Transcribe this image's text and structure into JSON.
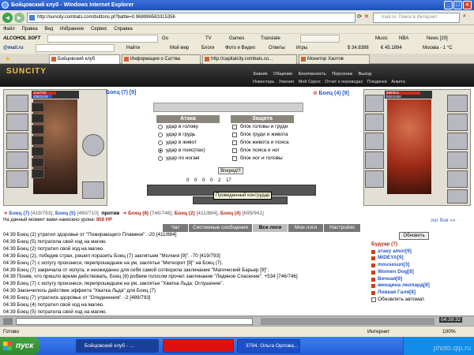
{
  "window": {
    "title": "Бойцовский клуб - Windows Internet Explorer"
  },
  "address": {
    "url": "http://suncity.combats.com/buttons.pl?battle=0.968996583315356",
    "search_placeholder": "mail.ru: Поиск в Интернет"
  },
  "menu": [
    "Файл",
    "Правка",
    "Вид",
    "Избранное",
    "Сервис",
    "Справка"
  ],
  "toolbar1": {
    "alcohol": "ALCOHOL SOFT",
    "go": "Go",
    "tv": "TV",
    "games": "Games",
    "translate": "Translate",
    "music": "Music",
    "nba": "NBA",
    "news": "News [20]"
  },
  "toolbar2": {
    "mailru": "@mail.ru",
    "find": "Найти",
    "moy_mir": "Мой мир",
    "blogs": "Блоги",
    "photo_video": "Фото и Видео",
    "answers": "Ответы",
    "games": "Игры",
    "usd": "$ 34.8388",
    "eur": "€ 45.1894",
    "weather": "Москва - 1 °С"
  },
  "tabs": [
    "Бойцовский клуб",
    "Информация о Саттва",
    "http://capitalcity.combats.co...",
    "Монитор Хаотов"
  ],
  "game": {
    "logo": "SUNCITY",
    "toplinks": [
      "Знания",
      "Общение",
      "Безопасность",
      "Персонаж",
      "Выход"
    ],
    "toplinks2": [
      "Инвентарь",
      "Умения",
      "Мой Скрол",
      "Отчет о переводах",
      "Плединки",
      "Анкета"
    ],
    "left_hp": "416/793",
    "left_mp": "428/1015",
    "left_name": "Боец (7)",
    "left_level": "[9]",
    "right_name": "Боец (4)",
    "right_level": "[9]",
    "right_hp": "695/941",
    "right_mp": "000/1000",
    "attack_title": "Атака",
    "attack_options": [
      "удар в голову",
      "удар в грудь",
      "удар в живот",
      "удар в пояс(пах)",
      "удар по ногам"
    ],
    "defense_title": "Защита",
    "defense_options": [
      "блок головы и груди",
      "блок груди и живота",
      "блок живота и пояса",
      "блок пояса и ног",
      "блок ног и головы"
    ],
    "forward": "Вперед!!!",
    "counters": [
      "0",
      "0",
      "0",
      "0",
      "2",
      "17"
    ],
    "tooltip": "Проведенный контрудар",
    "teamA": [
      {
        "n": "Боец (7)",
        "h": "[419/793]"
      },
      {
        "n": "Боец (5)",
        "h": "[460/710]"
      }
    ],
    "vs": "против",
    "teamB": [
      {
        "n": "Боец (8)",
        "h": "[746/746]"
      },
      {
        "n": "Боец (2)",
        "h": "[411/884]"
      },
      {
        "n": "Боец (4)",
        "h": "[695/941]"
      }
    ],
    "exp_label": "На данный момент вами нанесено урона:",
    "exp_value": "858 HP",
    "log_link": "лог боя »»",
    "chat_tabs": [
      "Чат",
      "Системные сообщения",
      "Все логи",
      "Мои логи",
      "Настройки"
    ],
    "refresh": "Обновить",
    "location": "Будуар (7)",
    "users": [
      "атаку amor[9]",
      "MIDEYA[9]",
      "mousesun[3]",
      "Women Dog[8]",
      "Вечная[9]",
      "женщина леопард[8]",
      "Ловкая Галя[8]"
    ],
    "auto_refresh": "Обновлять автомат.",
    "clock": "04:39:32"
  },
  "chat_lines": [
    "04:39 Боец (2) утратил здоровье от \"Пожирающего Пламени\". -20 [411/884]",
    "04:39 Боец (5) потратила свой ход на магию.",
    "04:39 Боец (2) потратил свой ход на магию.",
    "04:39 Боец (2), победив страх, решил поразить Боец (7) заклятьем \"Молния [9]\". -70 [419/793]",
    "04:39 Боец (7) с испугу произнеся, перепрошедшее на ум, заклятье \"Метеорит [9]\" на Боец (7).",
    "04:39 Боец (7) закричала от испуга, и неожиданно для себя самой сотворила заклинание \"Магический Барьер [9]\".",
    "04:39 Поняв, что пришло время действовать, Боец (8) робким голосом прочел заклинание \"Ледяное Спасение\". +534 [746/746]",
    "04:39 Боец (7) с испугу произнеся, перепрошедшее на ум, заклятье \"Хватка Льда: Оглушение\".",
    "04:39 Закончилось действие эффекта \"Хватка Льда\" для Боец (7)",
    "04:39 Боец (7) утратила здоровье от \"Оледенения\". -2 [489/793]",
    "04:39 Боец (4) потратил свой ход на магию.",
    "04:39 Боец (5) потратила свой ход на магию."
  ],
  "status": {
    "left": "Готово",
    "right": "Интернет",
    "zoom": "100%"
  },
  "taskbar": {
    "start": "пуск",
    "items": [
      "Бойцовский клуб - ...",
      "",
      "3794. Ольга Орлова..."
    ],
    "watermark": "photo.qip.ru"
  }
}
